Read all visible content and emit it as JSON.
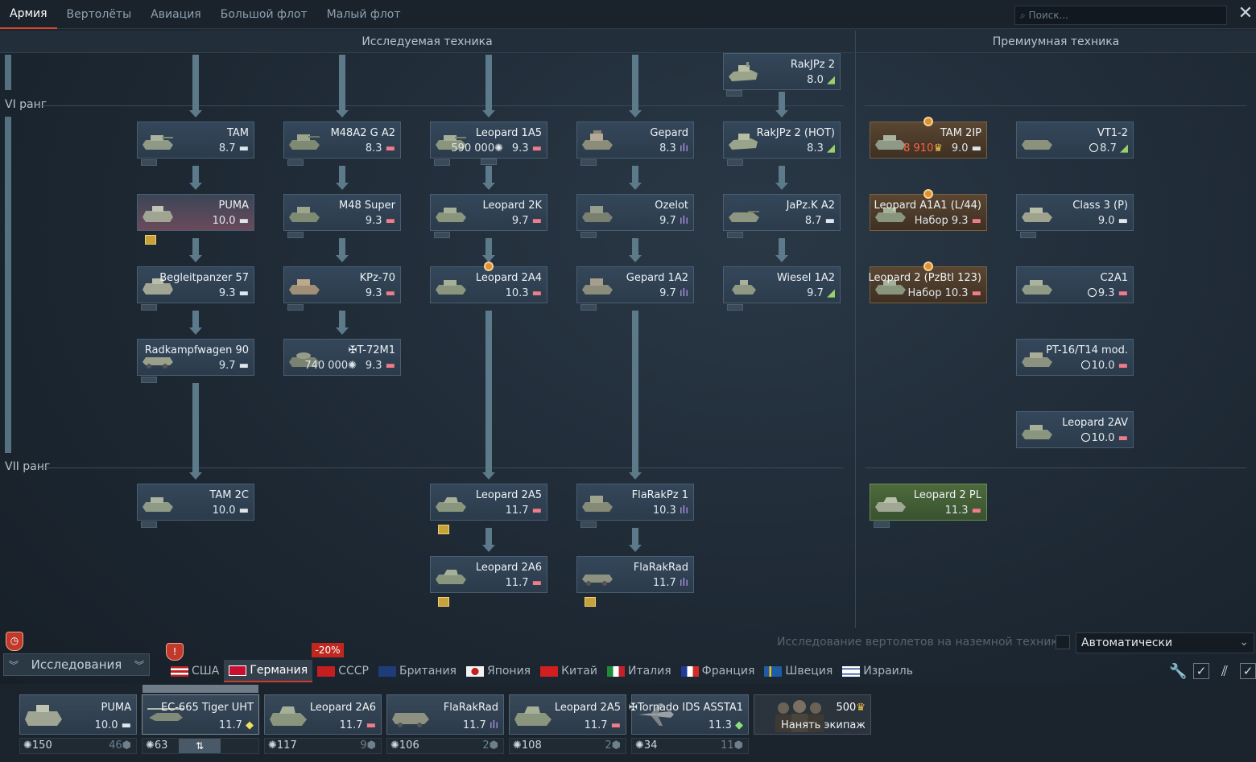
{
  "nav": {
    "tabs": [
      "Армия",
      "Вертолёты",
      "Авиация",
      "Большой флот",
      "Малый флот"
    ],
    "active_tab": "Армия",
    "search_placeholder": "Поиск...",
    "close": "✕"
  },
  "sections": {
    "researchable": "Исследуемая техника",
    "premium": "Премиумная техника"
  },
  "ranks": {
    "vi": "VI ранг",
    "vii": "VII ранг"
  },
  "vehicles": {
    "rakjpz2": {
      "name": "RakJPz 2",
      "br": "8.0"
    },
    "tam": {
      "name": "TAM",
      "br": "8.7"
    },
    "m48a2ga2": {
      "name": "M48A2 G A2",
      "br": "8.3"
    },
    "leopard1a5": {
      "name": "Leopard 1A5",
      "br": "9.3",
      "cost": "590 000"
    },
    "gepard": {
      "name": "Gepard",
      "br": "8.3"
    },
    "rakjpz2hot": {
      "name": "RakJPz 2 (HOT)",
      "br": "8.3"
    },
    "puma": {
      "name": "PUMA",
      "br": "10.0"
    },
    "m48super": {
      "name": "M48 Super",
      "br": "9.3"
    },
    "leopard2k": {
      "name": "Leopard 2K",
      "br": "9.7"
    },
    "ozelot": {
      "name": "Ozelot",
      "br": "9.7"
    },
    "japzka2": {
      "name": "JaPz.K A2",
      "br": "8.7"
    },
    "begleitpanzer": {
      "name": "Begleitpanzer 57",
      "br": "9.3"
    },
    "kpz70": {
      "name": "KPz-70",
      "br": "9.3"
    },
    "leopard2a4": {
      "name": "Leopard 2A4",
      "br": "10.3"
    },
    "gepard1a2": {
      "name": "Gepard 1A2",
      "br": "9.7"
    },
    "wiesel": {
      "name": "Wiesel 1A2",
      "br": "9.7"
    },
    "radkampf": {
      "name": "Radkampfwagen 90",
      "br": "9.7"
    },
    "t72m1": {
      "name": "✠T-72M1",
      "br": "9.3",
      "cost": "740 000"
    },
    "tam2c": {
      "name": "TAM 2C",
      "br": "10.0"
    },
    "leopard2a5": {
      "name": "Leopard 2A5",
      "br": "11.7"
    },
    "flarakpz": {
      "name": "FlaRakPz 1",
      "br": "10.3"
    },
    "leopard2a6": {
      "name": "Leopard 2A6",
      "br": "11.7"
    },
    "flarakrad": {
      "name": "FlaRakRad",
      "br": "11.7"
    }
  },
  "premium": {
    "tam2ip": {
      "name": "TAM 2IP",
      "br": "9.0",
      "cost": "8 910"
    },
    "vt12": {
      "name": "VT1-2",
      "br": "8.7"
    },
    "leopard_a1a1": {
      "name": "Leopard A1A1 (L/44)",
      "br": "9.3",
      "pack": "Набор"
    },
    "class3": {
      "name": "Class 3 (P)",
      "br": "9.0"
    },
    "leopard2pzbtl": {
      "name": "Leopard 2 (PzBtl 123)",
      "br": "10.3",
      "pack": "Набор"
    },
    "c2a1": {
      "name": "C2A1",
      "br": "9.3"
    },
    "pt16": {
      "name": "PT-16/T14 mod.",
      "br": "10.0"
    },
    "leopard2av": {
      "name": "Leopard 2AV",
      "br": "10.0"
    },
    "leopard2pl": {
      "name": "Leopard 2 PL",
      "br": "11.3"
    }
  },
  "bottom": {
    "research_note": "Исследование вертолетов на наземной технике",
    "dropdown_value": "Автоматически",
    "research_button": "Исследования",
    "discount": "-20%",
    "nations": [
      "США",
      "Германия",
      "СССР",
      "Британия",
      "Япония",
      "Китай",
      "Италия",
      "Франция",
      "Швеция",
      "Израиль"
    ],
    "active_nation": "Германия"
  },
  "crew": [
    {
      "name": "PUMA",
      "br": "10.0",
      "left": "150",
      "right": "46"
    },
    {
      "name": "EC-665 Tiger UHT",
      "br": "11.7",
      "left": "63",
      "right": ""
    },
    {
      "name": "Leopard 2A6",
      "br": "11.7",
      "left": "117",
      "right": "9"
    },
    {
      "name": "FlaRakRad",
      "br": "11.7",
      "left": "106",
      "right": "2"
    },
    {
      "name": "Leopard 2A5",
      "br": "11.7",
      "left": "108",
      "right": "2"
    },
    {
      "name": "✠Tornado IDS ASSTA1",
      "br": "11.3",
      "left": "34",
      "right": "11"
    }
  ],
  "hire": {
    "amount": "500",
    "label": "Нанять экипаж"
  },
  "colors": {
    "accent": "#d84a2a",
    "premium_card": "#5a4632",
    "squadron_green": "#4d6a3c",
    "discount": "#c0281f"
  }
}
